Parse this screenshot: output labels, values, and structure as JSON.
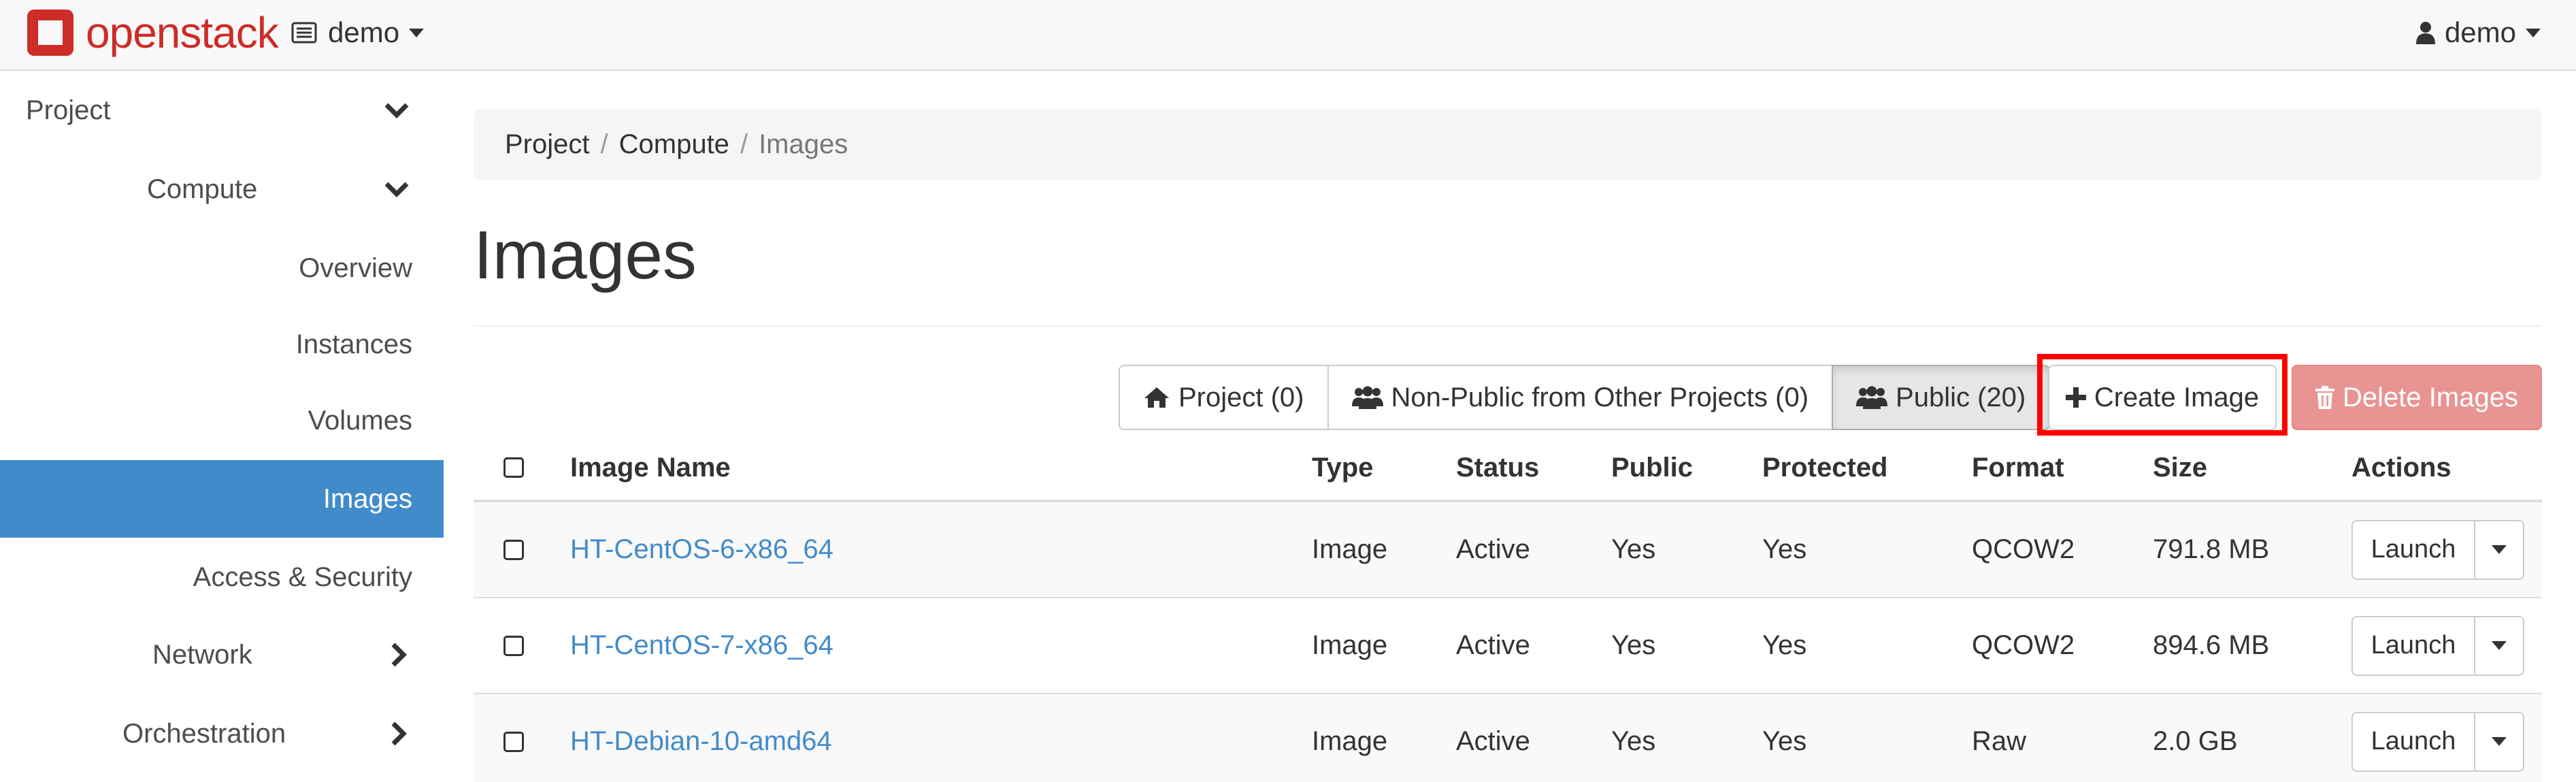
{
  "header": {
    "brand_text": "openstack",
    "project_selector": "demo",
    "user_menu": "demo"
  },
  "sidebar": {
    "items": [
      {
        "label": "Project",
        "chevron": "chevron-down-icon"
      },
      {
        "label": "Compute",
        "chevron": "chevron-down-icon"
      },
      {
        "label": "Overview"
      },
      {
        "label": "Instances"
      },
      {
        "label": "Volumes"
      },
      {
        "label": "Images",
        "active": true
      },
      {
        "label": "Access & Security"
      },
      {
        "label": "Network",
        "chevron": "chevron-right-icon"
      },
      {
        "label": "Orchestration",
        "chevron": "chevron-right-icon"
      }
    ]
  },
  "breadcrumb": {
    "items": [
      "Project",
      "Compute",
      "Images"
    ],
    "separator": "/"
  },
  "page": {
    "title": "Images"
  },
  "filters": {
    "project": "Project (0)",
    "non_public": "Non-Public from Other Projects (0)",
    "public": "Public (20)"
  },
  "actions": {
    "create": "Create Image",
    "delete": "Delete Images"
  },
  "table": {
    "columns": [
      "Image Name",
      "Type",
      "Status",
      "Public",
      "Protected",
      "Format",
      "Size",
      "Actions"
    ],
    "rows": [
      {
        "name": "HT-CentOS-6-x86_64",
        "type": "Image",
        "status": "Active",
        "public": "Yes",
        "protected": "Yes",
        "format": "QCOW2",
        "size": "791.8 MB",
        "action": "Launch"
      },
      {
        "name": "HT-CentOS-7-x86_64",
        "type": "Image",
        "status": "Active",
        "public": "Yes",
        "protected": "Yes",
        "format": "QCOW2",
        "size": "894.6 MB",
        "action": "Launch"
      },
      {
        "name": "HT-Debian-10-amd64",
        "type": "Image",
        "status": "Active",
        "public": "Yes",
        "protected": "Yes",
        "format": "Raw",
        "size": "2.0 GB",
        "action": "Launch"
      }
    ]
  },
  "colors": {
    "brand_red": "#cd2c28",
    "active_blue": "#428bca",
    "link_blue": "#428bca",
    "danger_disabled": "#e79492",
    "highlight_red": "#ff0000"
  }
}
